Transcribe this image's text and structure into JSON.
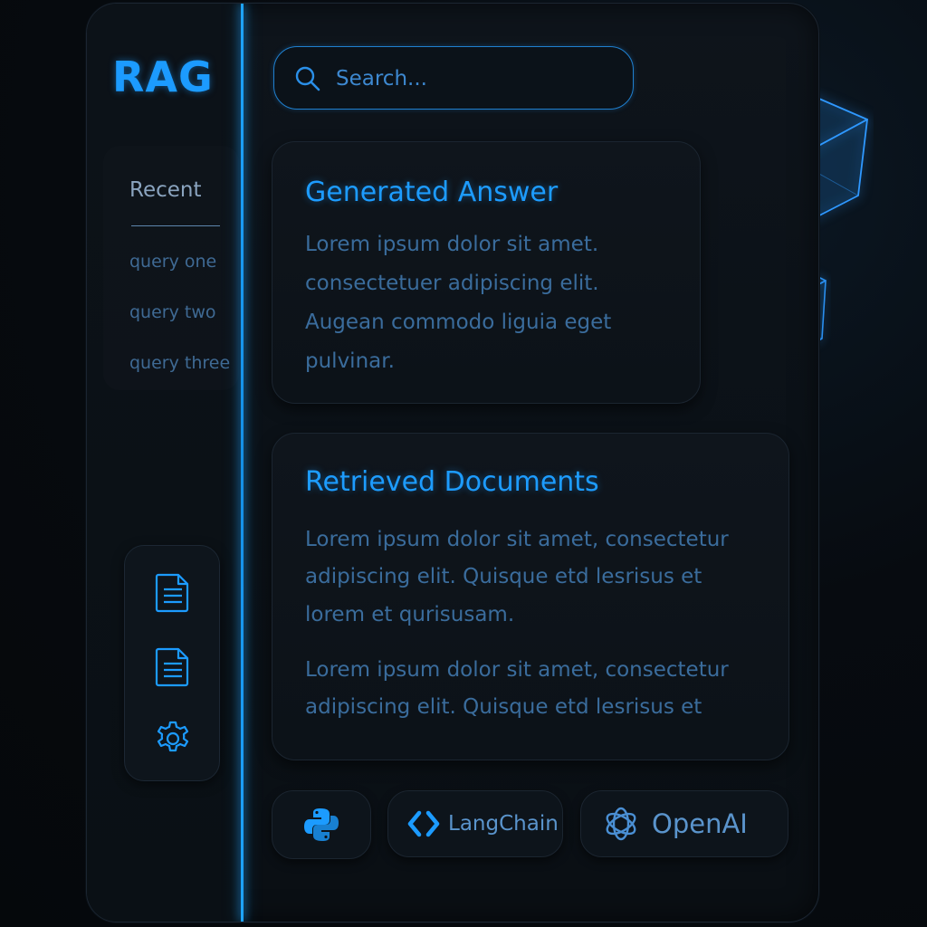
{
  "app": {
    "logo": "RAG"
  },
  "search": {
    "placeholder": "Search..."
  },
  "sidebar": {
    "recent_title": "Recent",
    "queries": [
      "query one",
      "query two",
      "query three"
    ],
    "tools": [
      {
        "icon": "document-icon"
      },
      {
        "icon": "document-icon"
      },
      {
        "icon": "gear-icon"
      }
    ]
  },
  "answer": {
    "title": "Generated Answer",
    "lines": [
      "Lorem ipsum dolor sit amet.",
      "consectetuer adipiscing elit.",
      "Augean commodo liguia eget",
      "pulvinar."
    ]
  },
  "documents": {
    "title": "Retrieved Documents",
    "paragraph1": [
      "Lorem ipsum dolor sit amet, consectetur",
      "adipiscing elit. Quisque etd lesrisus et",
      "lorem et qurisusam."
    ],
    "paragraph2": [
      "Lorem ipsum dolor sit amet, consectetur",
      "adipiscing elit. Quisque etd lesrisus et"
    ]
  },
  "integrations": {
    "python": {
      "icon": "python-icon"
    },
    "langchain": {
      "label": "LangChain",
      "icon": "langchain-icon"
    },
    "openai": {
      "label": "OpenAI",
      "icon": "openai-icon"
    }
  },
  "colors": {
    "accent": "#1c9bff",
    "body_text": "#3a6c9c",
    "background": "#06090d"
  }
}
